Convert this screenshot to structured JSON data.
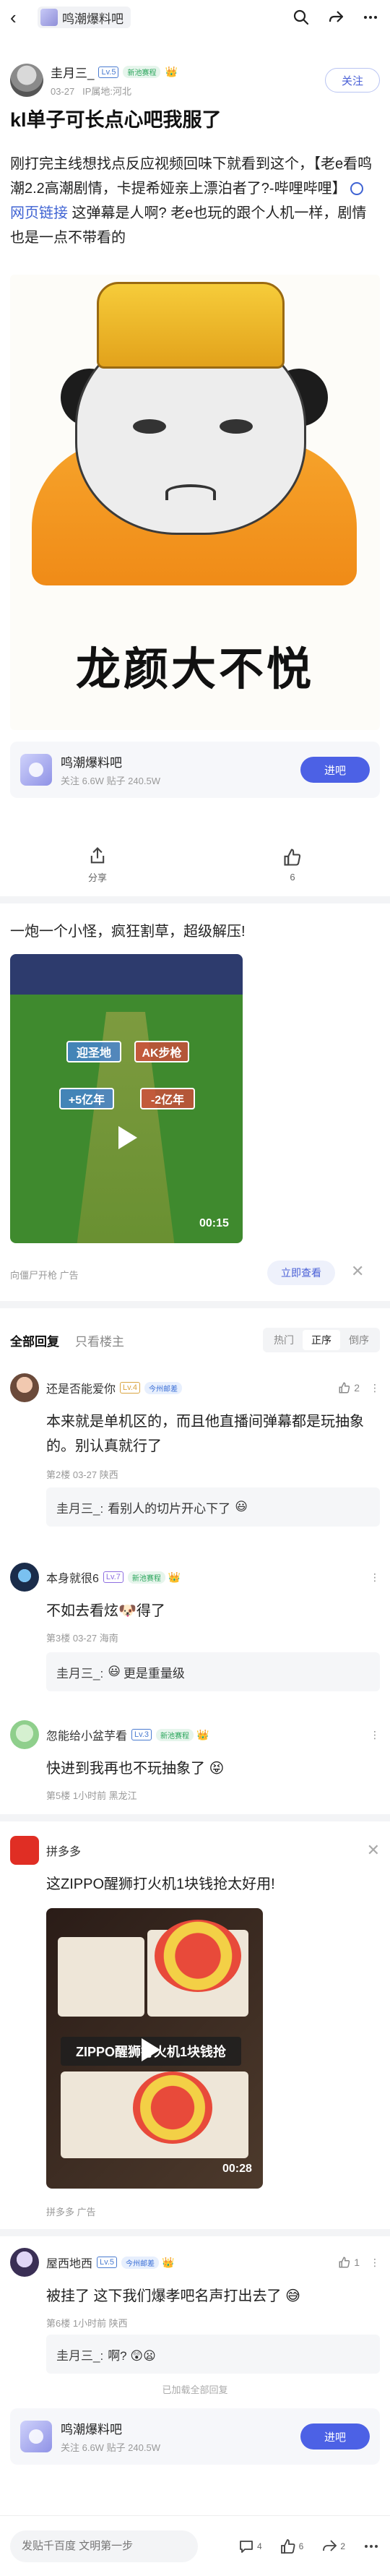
{
  "nav": {
    "forum_name": "鸣潮爆料吧"
  },
  "author": {
    "name": "圭月三_",
    "level": "Lv.5",
    "badge": "新池赛程",
    "date": "03-27",
    "ip": "IP属地:河北",
    "follow_label": "关注"
  },
  "post": {
    "title": "kl单子可长点心吧我服了",
    "body_part1": "刚打完主线想找点反应视频回味下就看到这个，【老e看鸣潮2.2高潮剧情，卡提希娅亲上漂泊者了?-哔哩哔哩】",
    "link_label": "网页链接",
    "body_part2": " 这弹幕是人啊? 老e也玩的跟个人机一样，剧情也是一点不带看的",
    "image_caption": "龙颜大不悦"
  },
  "forum_card": {
    "name": "鸣潮爆料吧",
    "stats": "关注 6.6W   贴子 240.5W",
    "enter_label": "进吧"
  },
  "actions": {
    "share_label": "分享",
    "like_count": "6"
  },
  "ad1": {
    "text": "一炮一个小怪，疯狂割草，超级解压!",
    "gate1": "迎圣地",
    "gate2": "AK步枪",
    "gate3": "+5亿年",
    "gate4": "-2亿年",
    "duration": "00:15",
    "source": "向僵尸开枪   广告",
    "visit_label": "立即查看"
  },
  "comments_header": {
    "all": "全部回复",
    "op_only": "只看楼主",
    "sort_hot": "热门",
    "sort_asc": "正序",
    "sort_desc": "倒序"
  },
  "comments": [
    {
      "name": "还是否能爱你",
      "level": "Lv.4",
      "badge": "今州邮差",
      "likes": "2",
      "text": "本来就是单机区的，而且他直播间弹幕都是玩抽象的。别认真就行了",
      "meta": "第2楼  03-27  陕西",
      "reply_name": "圭月三_:",
      "reply_text": "看别人的切片开心下了"
    },
    {
      "name": "本身就很6",
      "level": "Lv.7",
      "badge": "新池赛程",
      "text": "不如去看炫🐶得了",
      "meta": "第3楼  03-27  海南",
      "reply_name": "圭月三_:",
      "reply_text": "更是重量级"
    },
    {
      "name": "忽能给小盆芋看",
      "level": "Lv.3",
      "badge": "新池赛程",
      "text": "快进到我再也不玩抽象了 😝",
      "meta": "第5楼  1小时前  黑龙江"
    },
    {
      "name": "屋西地西",
      "level": "Lv.5",
      "badge": "今州邮差",
      "likes": "1",
      "text": "被挂了 这下我们爆孝吧名声打出去了 😅",
      "meta": "第6楼  1小时前  陕西",
      "reply_name": "圭月三_:",
      "reply_text": "啊? 😲😦"
    }
  ],
  "ad2": {
    "source_name": "拼多多",
    "text": "这ZIPPO醒狮打火机1块钱抢太好用!",
    "banner": "ZIPPO醒狮打火机1块钱抢",
    "duration": "00:28",
    "meta": "拼多多   广告"
  },
  "load_all": "已加载全部回复",
  "bottom": {
    "placeholder": "发贴千百度 文明第一步",
    "comment_count": "4",
    "like_count": "6",
    "share_count": "2"
  },
  "colors": {
    "accent": "#4c61e5",
    "link": "#3f63d3",
    "muted": "#999999"
  }
}
